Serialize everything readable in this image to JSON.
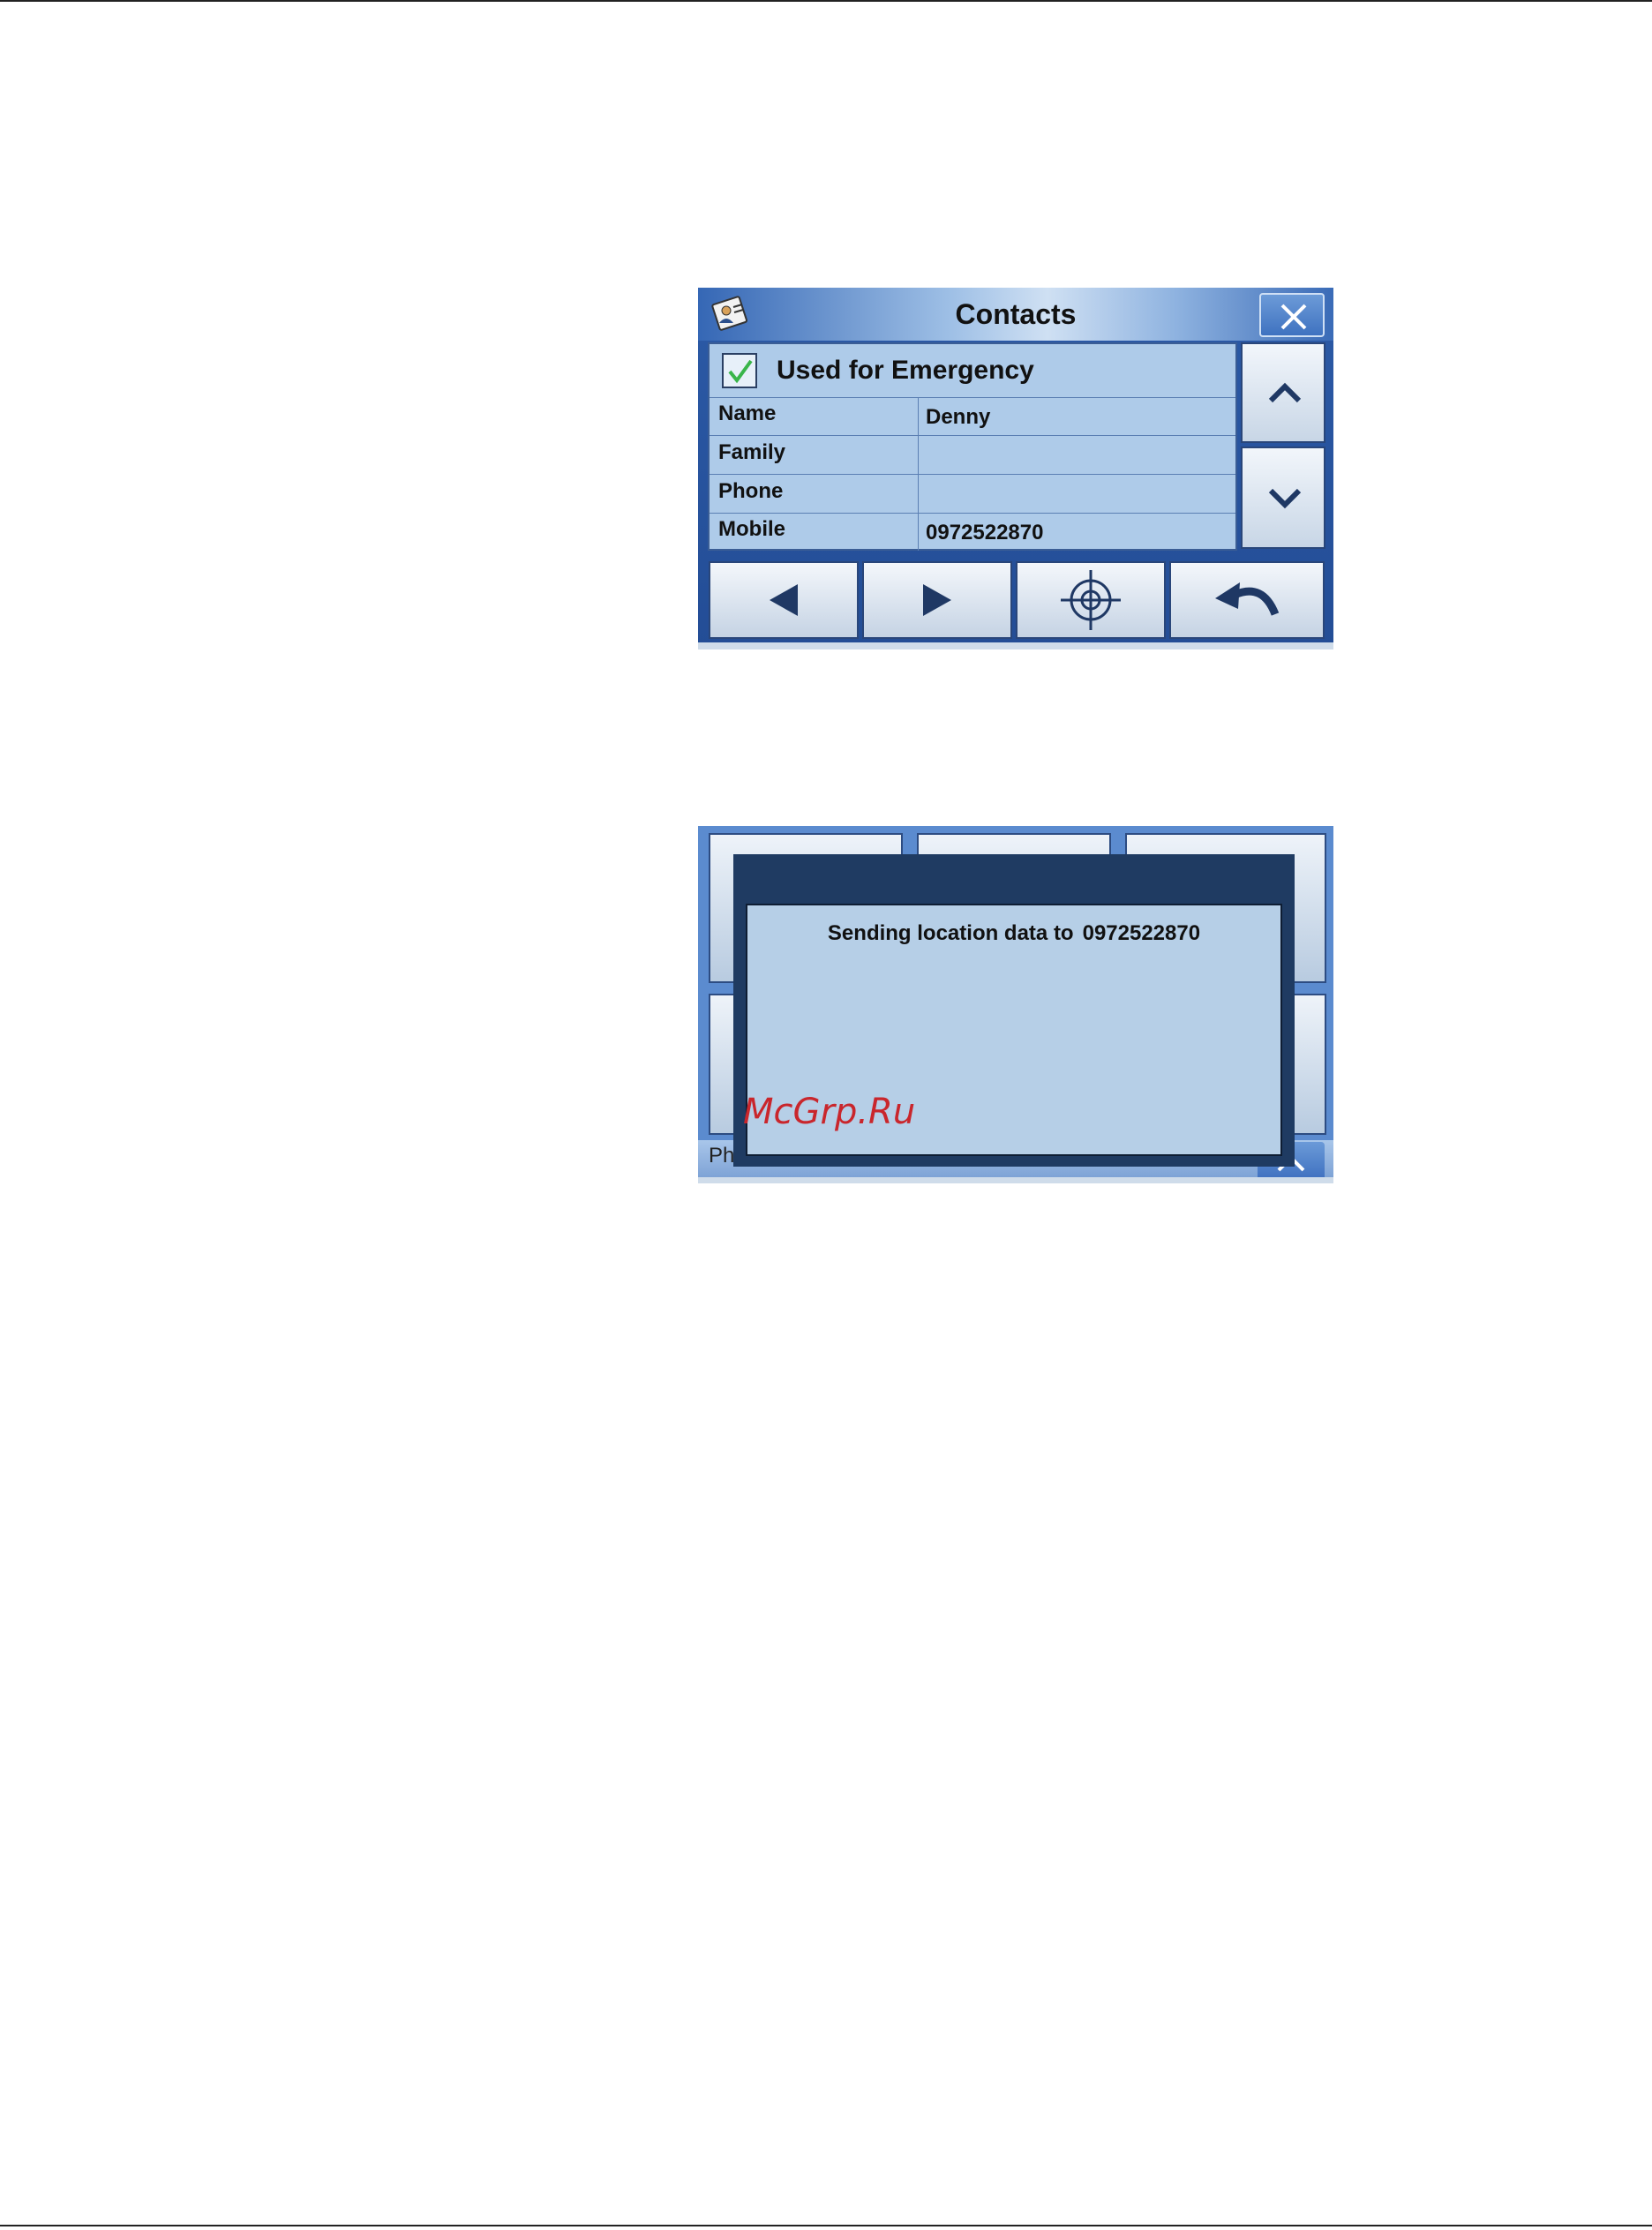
{
  "contacts_window": {
    "title": "Contacts",
    "title_icon": "contacts-book-icon",
    "close_icon": "close-icon",
    "emergency": {
      "label": "Used for Emergency",
      "checked": true
    },
    "fields": [
      {
        "label": "Name",
        "value": "Denny"
      },
      {
        "label": "Family",
        "value": ""
      },
      {
        "label": "Phone",
        "value": ""
      },
      {
        "label": "Mobile",
        "value": "0972522870"
      }
    ],
    "scroll": {
      "up_icon": "chevron-up-icon",
      "down_icon": "chevron-down-icon"
    },
    "toolbar": [
      {
        "name": "previous-button",
        "icon": "triangle-left-icon"
      },
      {
        "name": "next-button",
        "icon": "triangle-right-icon"
      },
      {
        "name": "send-location-button",
        "icon": "crosshair-icon"
      },
      {
        "name": "back-button",
        "icon": "undo-arrow-icon"
      }
    ],
    "colors": {
      "frame": "#234d96",
      "panel": "#aecbe9"
    }
  },
  "sending_window": {
    "message": "Sending location data to",
    "number": "0972522870",
    "status_bar_label": "Phone",
    "status_bar_icon": "chevron-up-icon",
    "colors": {
      "dialog_frame": "#1f3b62",
      "dialog_body": "#b6cfe7"
    }
  },
  "watermark": "McGrp.Ru"
}
